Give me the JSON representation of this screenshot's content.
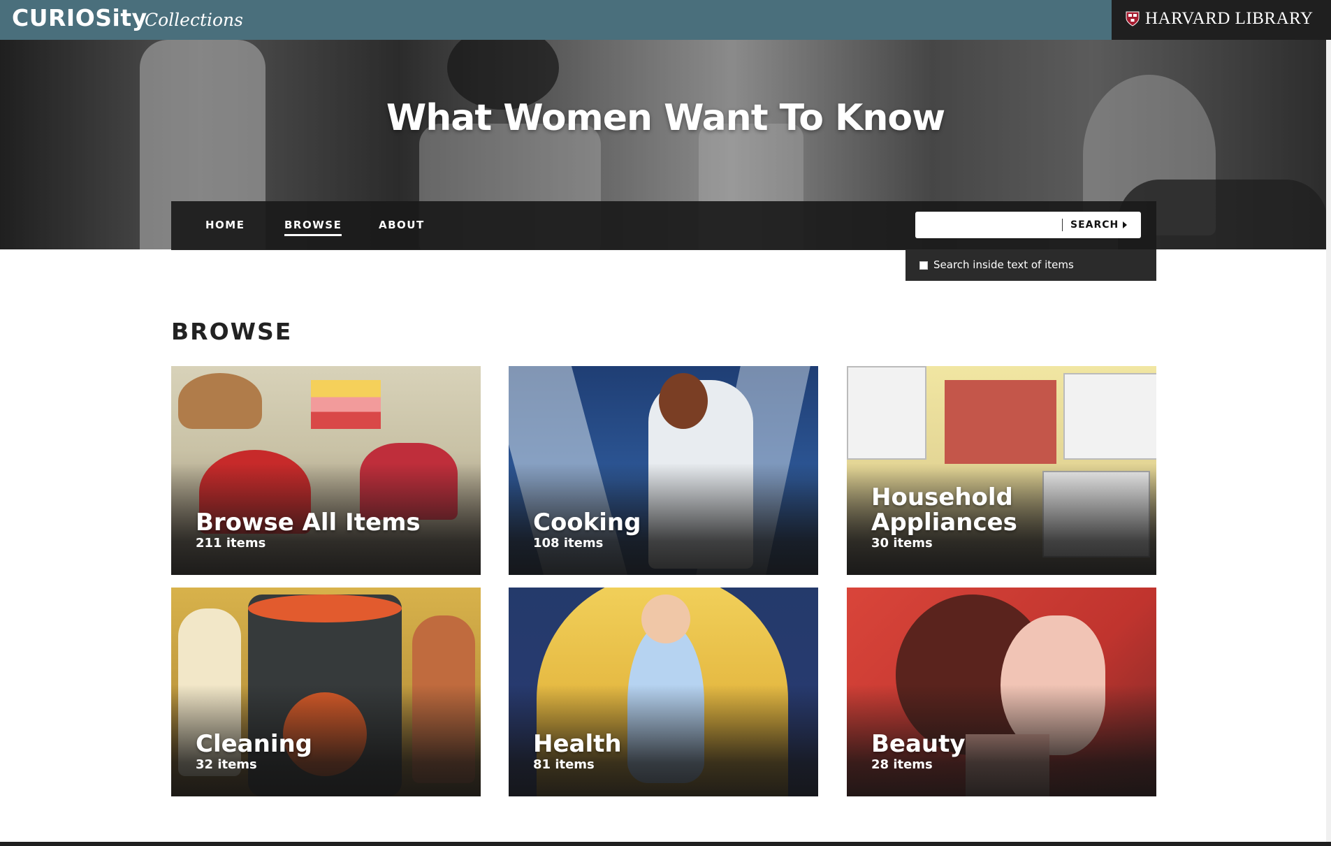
{
  "header": {
    "brand": "CURIOSity",
    "brand_sub": "Collections",
    "harvard": "HARVARD LIBRARY"
  },
  "hero": {
    "title": "What Women Want To Know"
  },
  "nav": {
    "items": [
      {
        "label": "HOME"
      },
      {
        "label": "BROWSE"
      },
      {
        "label": "ABOUT"
      }
    ],
    "search": {
      "placeholder": "",
      "button": "SEARCH",
      "option": "Search inside text of items"
    }
  },
  "browse": {
    "title": "BROWSE",
    "cards": [
      {
        "title": "Browse All Items",
        "count": "211 items"
      },
      {
        "title": "Cooking",
        "count": "108 items"
      },
      {
        "title": "Household Appliances",
        "count": "30 items"
      },
      {
        "title": "Cleaning",
        "count": "32 items"
      },
      {
        "title": "Health",
        "count": "81 items"
      },
      {
        "title": "Beauty",
        "count": "28 items"
      }
    ]
  },
  "colors": {
    "topbar": "#4a6f7c",
    "harvard_bg": "#1f1f1f",
    "nav_bg": "#1a1a1a"
  },
  "icons": {
    "shield": "shield-icon",
    "play": "play-arrow-icon",
    "checkbox": "checkbox-icon"
  }
}
